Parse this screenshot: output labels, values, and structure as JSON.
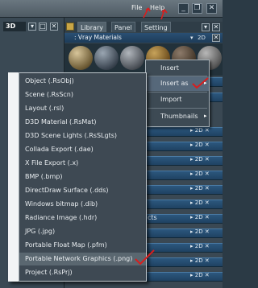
{
  "menubar": {
    "file_label": "File",
    "help_label": "Help",
    "min_icon": "minimize-icon",
    "restore_icon": "restore-icon",
    "close_icon": "close-icon"
  },
  "viewport": {
    "tab_label": "3D"
  },
  "tabs": {
    "library": "Library",
    "panel": "Panel",
    "setting": "Setting"
  },
  "vray_header": {
    "title": ": Vray Materials",
    "mode": "2D"
  },
  "panel_row_2d": "2D",
  "submenu": {
    "items": [
      "Insert",
      "Insert as",
      "Import",
      "Thumbnails"
    ]
  },
  "export_menu": {
    "items": [
      "Object (.RsObj)",
      "Scene (.RsScn)",
      "Layout (.rsl)",
      "D3D Material (.RsMat)",
      "D3D Scene Lights (.RsSLgts)",
      "Collada Export (.dae)",
      "X File Export (.x)",
      "BMP (.bmp)",
      "DirectDraw Surface (.dds)",
      "Windows bitmap (.dib)",
      "Radiance Image (.hdr)",
      "JPG (.jpg)",
      "Portable Float Map (.pfm)",
      "Portable Network Graphics (.png)",
      "Project (.RsPrj)"
    ],
    "highlighted": "Portable Network Graphics (.png)"
  },
  "partial_texts": {
    "cts": "cts"
  },
  "colors": {
    "annotation": "#d81e1e",
    "highlight": "#5a6770"
  }
}
